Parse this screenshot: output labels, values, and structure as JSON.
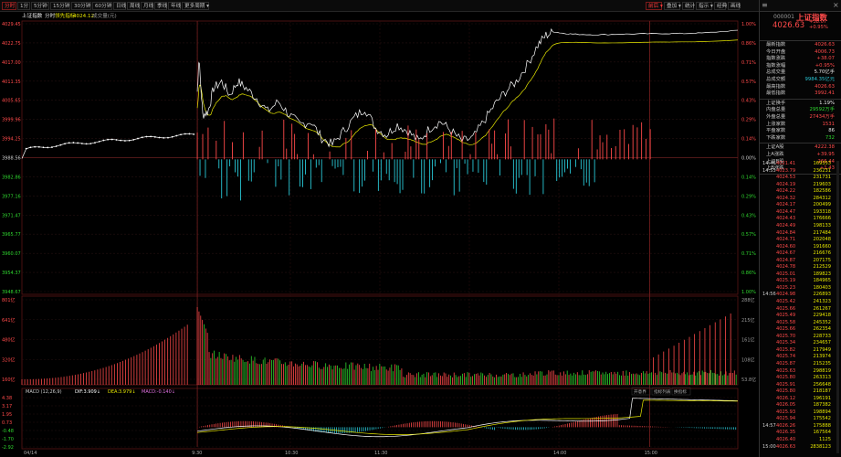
{
  "toolbar": {
    "left_items": [
      "分时",
      "1分",
      "5分钟",
      "15分钟",
      "30分钟",
      "60分钟",
      "日线",
      "周线",
      "月线",
      "季线",
      "年线",
      "更多周期 ▾"
    ],
    "right_items": [
      "前后 ▾",
      "叠加 ▾",
      "统计",
      "指示 ▾",
      "经典",
      "画线"
    ]
  },
  "infobar": {
    "index_name": "上证指数",
    "mode": "分时",
    "lead_label": "领先指标",
    "lead_value": "4024.12",
    "volume_label": "成交量(元)"
  },
  "price_axis": {
    "left": [
      "4029.45",
      "4022.75",
      "4017.00",
      "4011.35",
      "4005.65",
      "3999.96",
      "3994.25",
      "3988.56",
      "3982.86",
      "3977.16",
      "3971.47",
      "3965.77",
      "3960.07",
      "3954.37",
      "3948.67"
    ],
    "right": [
      "1.00%",
      "0.86%",
      "0.71%",
      "0.57%",
      "0.43%",
      "0.29%",
      "0.14%",
      "0.00%",
      "0.14%",
      "0.29%",
      "0.43%",
      "0.57%",
      "0.71%",
      "0.86%",
      "1.00%"
    ],
    "baseline": "3988.56"
  },
  "volume_axis": {
    "left": [
      "801亿",
      "641亿",
      "480亿",
      "320亿",
      "160亿"
    ],
    "right": [
      "288亿",
      "215亿",
      "161亿",
      "108亿",
      "53.8亿"
    ]
  },
  "macd": {
    "label": "MACD (12,26,9)",
    "dif": "DIF:3.909↓",
    "dea": "DEA:3.979↓",
    "macd": "MACD:-0.140↓",
    "axis": [
      "4.38",
      "3.17",
      "1.95",
      "0.73",
      "-0.48",
      "-1.70",
      "-2.92"
    ],
    "buttons": [
      "开意界",
      "指标列表",
      "换指标"
    ]
  },
  "time_axis": [
    "04/14",
    "9:30",
    "10:30",
    "11:30",
    "14:00",
    "15:00"
  ],
  "quote": {
    "code": "000001",
    "name": "上证指数",
    "price": "4026.63",
    "change": "+38.07",
    "change_pct": "+0.95%",
    "rows": [
      {
        "k": "最新指数",
        "v": "4026.63",
        "c": "red"
      },
      {
        "k": "今日开盘",
        "v": "4006.73",
        "c": "red"
      },
      {
        "k": "指数涨跌",
        "v": "+38.07",
        "c": "red"
      },
      {
        "k": "指数涨幅",
        "v": "+0.95%",
        "c": "red"
      },
      {
        "k": "总成交量",
        "v": "5.70亿手",
        "c": "white"
      },
      {
        "k": "总成交额",
        "v": "9984.35亿元",
        "c": "cyan"
      },
      {
        "k": "最高指数",
        "v": "4026.63",
        "c": "red"
      },
      {
        "k": "最低指数",
        "v": "3992.41",
        "c": "red"
      }
    ],
    "rows2": [
      {
        "k": "上证换手",
        "v": "1.19%",
        "c": "white"
      },
      {
        "k": "内盘总量",
        "v": "29592万手",
        "c": "green"
      },
      {
        "k": "外盘总量",
        "v": "27434万手",
        "c": "red"
      },
      {
        "k": "上涨家数",
        "v": "1531",
        "c": "red"
      },
      {
        "k": "平盘家数",
        "v": "86",
        "c": "white"
      },
      {
        "k": "下跌家数",
        "v": "732",
        "c": "green"
      }
    ],
    "rows3": [
      {
        "k": "上证A股",
        "v": "4222.38",
        "c": "red"
      },
      {
        "k": "上A涨跌",
        "v": "+39.95",
        "c": "red"
      },
      {
        "k": "上证B股",
        "v": "266.44",
        "c": "red"
      },
      {
        "k": "上B涨跌",
        "v": "+1.43",
        "c": "red"
      }
    ]
  },
  "ticks": [
    {
      "t": "14:46",
      "p": "4021.41",
      "v": "169353"
    },
    {
      "t": "14:55",
      "p": "4023.79",
      "v": "236231"
    },
    {
      "t": "",
      "p": "4024.53",
      "v": "231731"
    },
    {
      "t": "",
      "p": "4024.19",
      "v": "219603"
    },
    {
      "t": "",
      "p": "4024.22",
      "v": "182586"
    },
    {
      "t": "",
      "p": "4024.32",
      "v": "284312"
    },
    {
      "t": "",
      "p": "4024.17",
      "v": "200499"
    },
    {
      "t": "",
      "p": "4024.47",
      "v": "193318"
    },
    {
      "t": "",
      "p": "4024.43",
      "v": "176666"
    },
    {
      "t": "",
      "p": "4024.49",
      "v": "198133"
    },
    {
      "t": "",
      "p": "4024.84",
      "v": "217484"
    },
    {
      "t": "",
      "p": "4024.71",
      "v": "202048"
    },
    {
      "t": "",
      "p": "4024.60",
      "v": "191660"
    },
    {
      "t": "",
      "p": "4024.67",
      "v": "216676"
    },
    {
      "t": "",
      "p": "4024.87",
      "v": "207175"
    },
    {
      "t": "",
      "p": "4024.78",
      "v": "212529"
    },
    {
      "t": "",
      "p": "4025.01",
      "v": "189823"
    },
    {
      "t": "",
      "p": "4025.19",
      "v": "184965"
    },
    {
      "t": "",
      "p": "4025.23",
      "v": "180403"
    },
    {
      "t": "14:56",
      "p": "4024.98",
      "v": "226893"
    },
    {
      "t": "",
      "p": "4025.42",
      "v": "241323"
    },
    {
      "t": "",
      "p": "4025.66",
      "v": "261267"
    },
    {
      "t": "",
      "p": "4025.49",
      "v": "229418"
    },
    {
      "t": "",
      "p": "4025.58",
      "v": "245352"
    },
    {
      "t": "",
      "p": "4025.66",
      "v": "262354"
    },
    {
      "t": "",
      "p": "4025.70",
      "v": "228733"
    },
    {
      "t": "",
      "p": "4025.34",
      "v": "234657"
    },
    {
      "t": "",
      "p": "4025.82",
      "v": "217949"
    },
    {
      "t": "",
      "p": "4025.74",
      "v": "213974"
    },
    {
      "t": "",
      "p": "4025.87",
      "v": "215235"
    },
    {
      "t": "",
      "p": "4025.63",
      "v": "298819"
    },
    {
      "t": "",
      "p": "4025.80",
      "v": "263313"
    },
    {
      "t": "",
      "p": "4025.91",
      "v": "256648"
    },
    {
      "t": "",
      "p": "4025.80",
      "v": "218187"
    },
    {
      "t": "",
      "p": "4026.12",
      "v": "196191"
    },
    {
      "t": "",
      "p": "4026.05",
      "v": "187382"
    },
    {
      "t": "",
      "p": "4025.93",
      "v": "198894"
    },
    {
      "t": "",
      "p": "4025.94",
      "v": "175542"
    },
    {
      "t": "14:57",
      "p": "4026.26",
      "v": "175888"
    },
    {
      "t": "",
      "p": "4026.35",
      "v": "167564"
    },
    {
      "t": "",
      "p": "4026.40",
      "v": "1125"
    },
    {
      "t": "15:00",
      "p": "4026.63",
      "v": "2838123"
    }
  ],
  "colors": {
    "up": "#ff4a4a",
    "down": "#2fd62f",
    "price_line": "#ffffff",
    "avg_line": "#e8e800",
    "neg_bar": "#29c7d6",
    "grid": "#3a1010"
  }
}
